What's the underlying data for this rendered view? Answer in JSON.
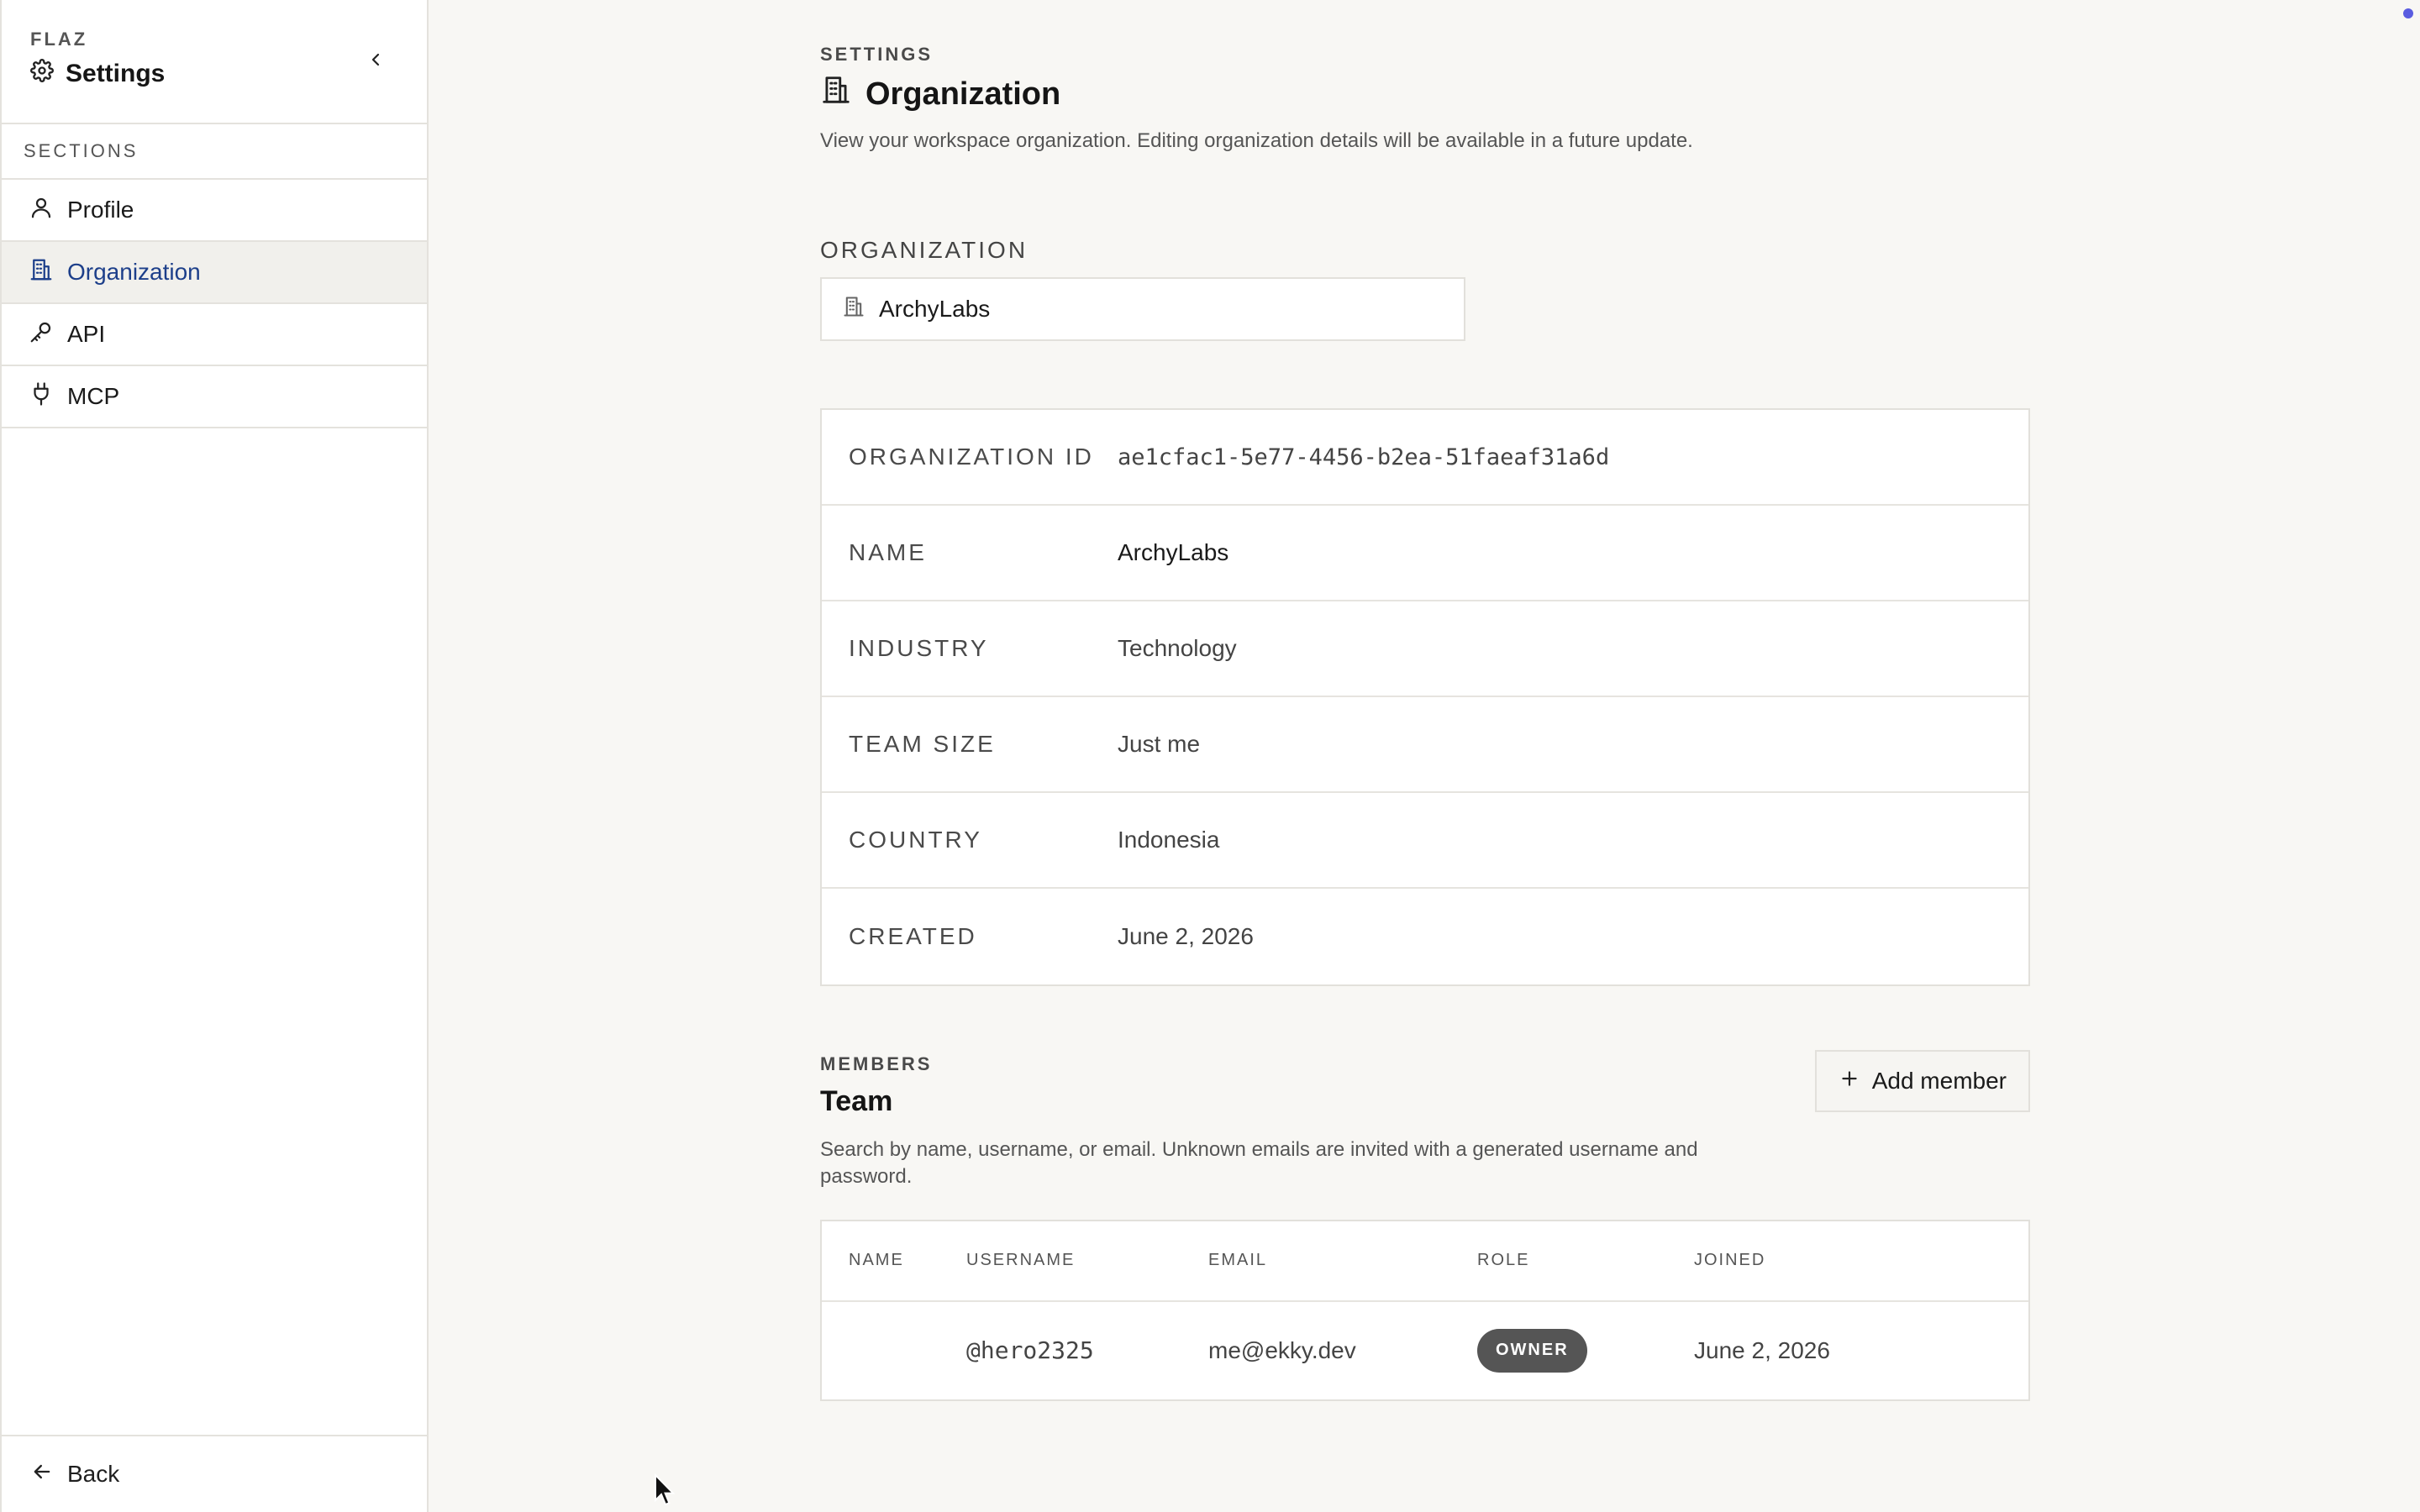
{
  "sidebar": {
    "brand": "FLAZ",
    "title": "Settings",
    "sections_label": "SECTIONS",
    "items": [
      {
        "label": "Profile",
        "icon": "user-icon"
      },
      {
        "label": "Organization",
        "icon": "building-icon",
        "active": true
      },
      {
        "label": "API",
        "icon": "key-icon"
      },
      {
        "label": "MCP",
        "icon": "plug-icon"
      }
    ],
    "back_label": "Back"
  },
  "page": {
    "eyebrow": "SETTINGS",
    "title": "Organization",
    "description": "View your workspace organization. Editing organization details will be available in a future update."
  },
  "org_field": {
    "label": "ORGANIZATION",
    "value": "ArchyLabs"
  },
  "details": [
    {
      "key": "ORGANIZATION ID",
      "value": "ae1cfac1-5e77-4456-b2ea-51faeaf31a6d"
    },
    {
      "key": "NAME",
      "value": "ArchyLabs"
    },
    {
      "key": "INDUSTRY",
      "value": "Technology"
    },
    {
      "key": "TEAM SIZE",
      "value": "Just me"
    },
    {
      "key": "COUNTRY",
      "value": "Indonesia"
    },
    {
      "key": "CREATED",
      "value": "June 2, 2026"
    }
  ],
  "members": {
    "eyebrow": "MEMBERS",
    "title": "Team",
    "description": "Search by name, username, or email. Unknown emails are invited with a generated username and password.",
    "add_button": "Add member",
    "columns": [
      "NAME",
      "USERNAME",
      "EMAIL",
      "ROLE",
      "JOINED"
    ],
    "rows": [
      {
        "name": "",
        "username": "@hero2325",
        "email": "me@ekky.dev",
        "role": "OWNER",
        "joined": "June 2, 2026"
      }
    ]
  },
  "colors": {
    "accent": "#1d3f8a",
    "badge": "#555555",
    "background": "#f8f7f4"
  }
}
